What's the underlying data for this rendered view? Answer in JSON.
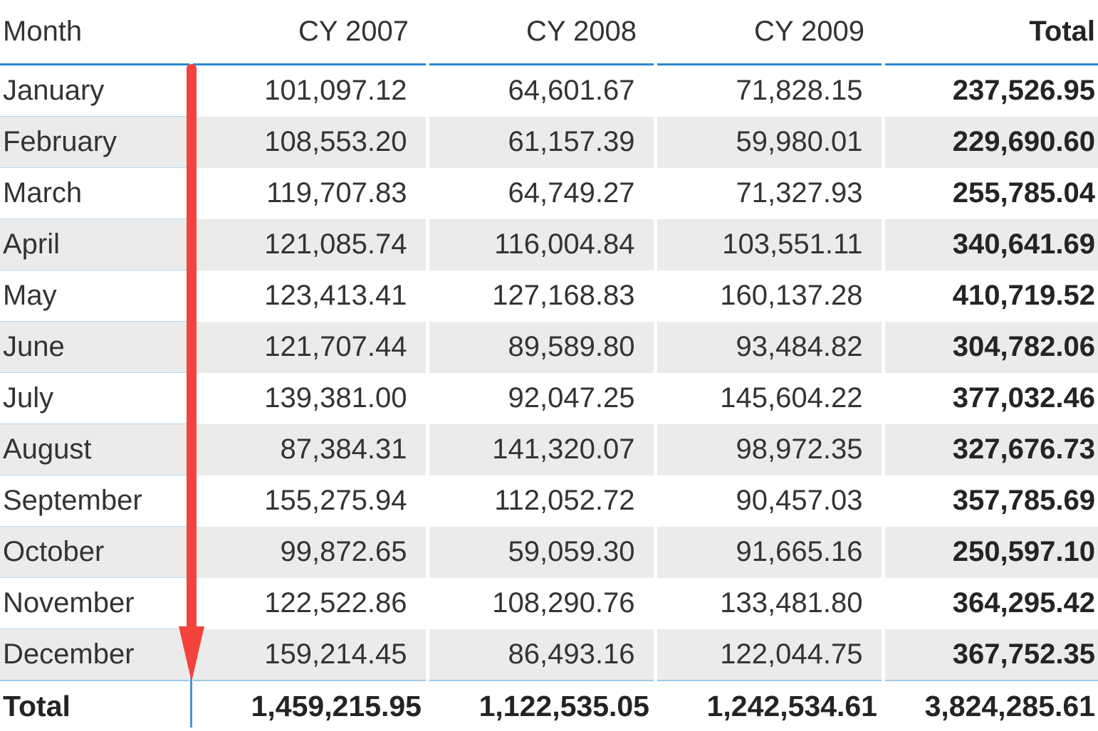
{
  "visual": {
    "type": "matrix-table",
    "accent_color": "#2b87d3",
    "annotation_color": "#f4433d",
    "alt_row_color": "#ebebeb",
    "text_color": "#333333"
  },
  "table": {
    "columns": [
      {
        "key": "month",
        "label": "Month",
        "align": "left",
        "bold": false
      },
      {
        "key": "cy2007",
        "label": "CY 2007",
        "align": "right",
        "bold": false
      },
      {
        "key": "cy2008",
        "label": "CY 2008",
        "align": "right",
        "bold": false
      },
      {
        "key": "cy2009",
        "label": "CY 2009",
        "align": "right",
        "bold": false
      },
      {
        "key": "total",
        "label": "Total",
        "align": "right",
        "bold": true
      }
    ],
    "rows": [
      {
        "month": "January",
        "cy2007": "101,097.12",
        "cy2008": "64,601.67",
        "cy2009": "71,828.15",
        "total": "237,526.95"
      },
      {
        "month": "February",
        "cy2007": "108,553.20",
        "cy2008": "61,157.39",
        "cy2009": "59,980.01",
        "total": "229,690.60"
      },
      {
        "month": "March",
        "cy2007": "119,707.83",
        "cy2008": "64,749.27",
        "cy2009": "71,327.93",
        "total": "255,785.04"
      },
      {
        "month": "April",
        "cy2007": "121,085.74",
        "cy2008": "116,004.84",
        "cy2009": "103,551.11",
        "total": "340,641.69"
      },
      {
        "month": "May",
        "cy2007": "123,413.41",
        "cy2008": "127,168.83",
        "cy2009": "160,137.28",
        "total": "410,719.52"
      },
      {
        "month": "June",
        "cy2007": "121,707.44",
        "cy2008": "89,589.80",
        "cy2009": "93,484.82",
        "total": "304,782.06"
      },
      {
        "month": "July",
        "cy2007": "139,381.00",
        "cy2008": "92,047.25",
        "cy2009": "145,604.22",
        "total": "377,032.46"
      },
      {
        "month": "August",
        "cy2007": "87,384.31",
        "cy2008": "141,320.07",
        "cy2009": "98,972.35",
        "total": "327,676.73"
      },
      {
        "month": "September",
        "cy2007": "155,275.94",
        "cy2008": "112,052.72",
        "cy2009": "90,457.03",
        "total": "357,785.69"
      },
      {
        "month": "October",
        "cy2007": "99,872.65",
        "cy2008": "59,059.30",
        "cy2009": "91,665.16",
        "total": "250,597.10"
      },
      {
        "month": "November",
        "cy2007": "122,522.86",
        "cy2008": "108,290.76",
        "cy2009": "133,481.80",
        "total": "364,295.42"
      },
      {
        "month": "December",
        "cy2007": "159,214.45",
        "cy2008": "86,493.16",
        "cy2009": "122,044.75",
        "total": "367,752.35"
      }
    ],
    "grand_total": {
      "month": "Total",
      "cy2007": "1,459,215.95",
      "cy2008": "1,122,535.05",
      "cy2009": "1,242,534.61",
      "total": "3,824,285.61"
    }
  },
  "annotation": {
    "name": "down-arrow",
    "color": "#f4433d",
    "direction": "down"
  },
  "chart_data": {
    "type": "table",
    "title": "Monthly sales by calendar year",
    "categories": [
      "January",
      "February",
      "March",
      "April",
      "May",
      "June",
      "July",
      "August",
      "September",
      "October",
      "November",
      "December"
    ],
    "series": [
      {
        "name": "CY 2007",
        "values": [
          101097.12,
          108553.2,
          119707.83,
          121085.74,
          123413.41,
          121707.44,
          139381.0,
          87384.31,
          155275.94,
          99872.65,
          122522.86,
          159214.45
        ],
        "total": 1459215.95
      },
      {
        "name": "CY 2008",
        "values": [
          64601.67,
          61157.39,
          64749.27,
          116004.84,
          127168.83,
          89589.8,
          92047.25,
          141320.07,
          112052.72,
          59059.3,
          108290.76,
          86493.16
        ],
        "total": 1122535.05
      },
      {
        "name": "CY 2009",
        "values": [
          71828.15,
          59980.01,
          71327.93,
          103551.11,
          160137.28,
          93484.82,
          145604.22,
          98972.35,
          90457.03,
          91665.16,
          133481.8,
          122044.75
        ],
        "total": 1242534.61
      },
      {
        "name": "Total",
        "values": [
          237526.95,
          229690.6,
          255785.04,
          340641.69,
          410719.52,
          304782.06,
          377032.46,
          327676.73,
          357785.69,
          250597.1,
          364295.42,
          367752.35
        ],
        "total": 3824285.61
      }
    ],
    "xlabel": "Month",
    "ylabel": "",
    "grand_total": 3824285.61
  }
}
